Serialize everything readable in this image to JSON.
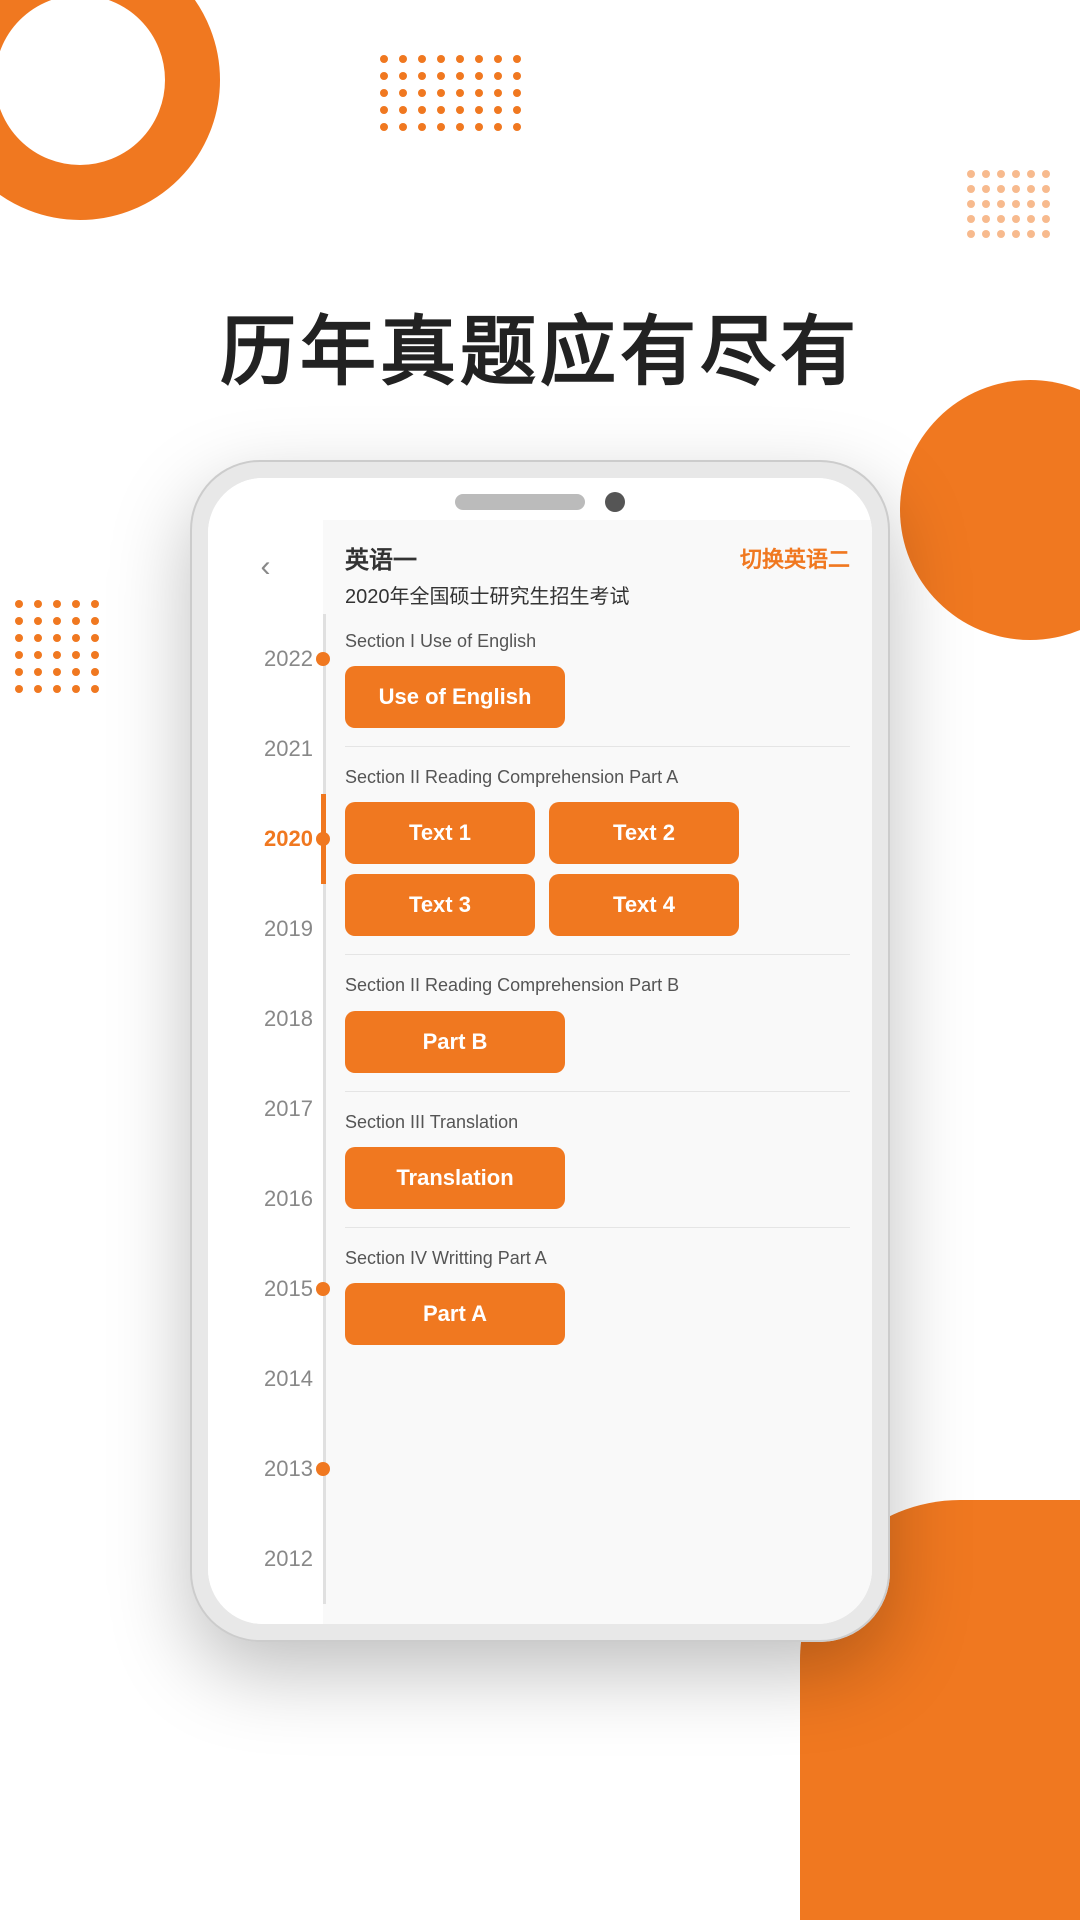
{
  "page": {
    "title": "历年真题应有尽有",
    "bg_dots_rows": 5,
    "bg_dots_cols": 8
  },
  "sidebar": {
    "back_arrow": "‹",
    "years": [
      {
        "year": "2022",
        "active": false,
        "has_dot": true
      },
      {
        "year": "2021",
        "active": false,
        "has_dot": false
      },
      {
        "year": "2020",
        "active": true,
        "has_dot": true
      },
      {
        "year": "2019",
        "active": false,
        "has_dot": false
      },
      {
        "year": "2018",
        "active": false,
        "has_dot": false
      },
      {
        "year": "2017",
        "active": false,
        "has_dot": false
      },
      {
        "year": "2016",
        "active": false,
        "has_dot": false
      },
      {
        "year": "2015",
        "active": false,
        "has_dot": true
      },
      {
        "year": "2014",
        "active": false,
        "has_dot": false
      },
      {
        "year": "2013",
        "active": false,
        "has_dot": true
      },
      {
        "year": "2012",
        "active": false,
        "has_dot": false
      }
    ]
  },
  "app": {
    "language_label": "英语一",
    "switch_label": "切换英语二",
    "exam_title": "2020年全国硕士研究生招生考试",
    "sections": [
      {
        "id": "section1",
        "label": "Section I Use of English",
        "buttons": [
          {
            "label": "Use of English",
            "wide": true
          }
        ]
      },
      {
        "id": "section2",
        "label": "Section II Reading Comprehension Part A",
        "buttons": [
          {
            "label": "Text 1"
          },
          {
            "label": "Text 2"
          },
          {
            "label": "Text 3"
          },
          {
            "label": "Text 4"
          }
        ]
      },
      {
        "id": "section3",
        "label": "Section II Reading Comprehension Part B",
        "buttons": [
          {
            "label": "Part B",
            "wide": true
          }
        ]
      },
      {
        "id": "section4",
        "label": "Section III Translation",
        "buttons": [
          {
            "label": "Translation",
            "wide": true
          }
        ]
      },
      {
        "id": "section5",
        "label": "Section IV Writting Part A",
        "buttons": [
          {
            "label": "Part A",
            "wide": true
          }
        ]
      }
    ]
  },
  "colors": {
    "orange": "#f07820",
    "text_dark": "#222222",
    "text_gray": "#888888",
    "bg_light": "#f9f9f9"
  }
}
